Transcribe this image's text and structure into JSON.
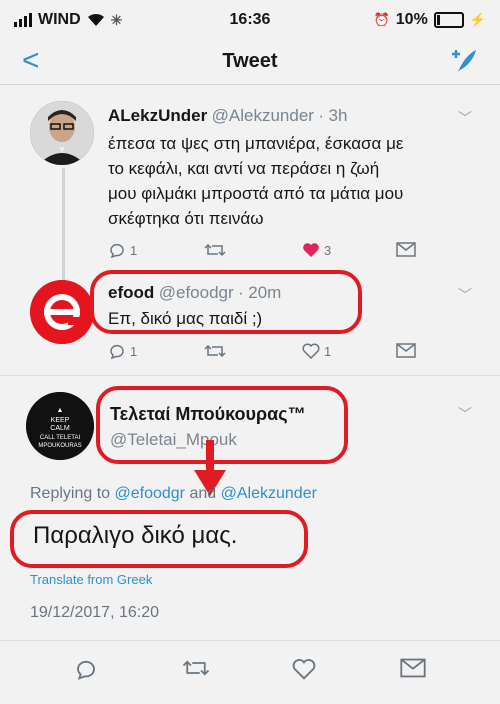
{
  "status": {
    "carrier": "WIND",
    "time": "16:36",
    "battery": "10%"
  },
  "nav": {
    "back": "<",
    "title": "Tweet"
  },
  "tweet1": {
    "name": "ALekzUnder",
    "handle": "@Alekzunder",
    "time": "3h",
    "lines": [
      "έπεσα τα ψες στη μπανιέρα, έσκασα με",
      "το κεφάλι, και αντί να περάσει η ζωή",
      "μου φιλμάκι μπροστά από τα μάτια μου",
      "σκέφτηκα ότι πεινάω"
    ],
    "reply_count": "1",
    "like_count": "3"
  },
  "tweet2": {
    "name": "efood",
    "handle": "@efoodgr",
    "time": "20m",
    "text": "Επ, δικό μας παιδί ;)",
    "reply_count": "1",
    "like_count": "1",
    "avatar_letter": "e"
  },
  "tweet3": {
    "name": "Τελεταί Μπούκουρας™",
    "handle": "@Teletai_Mpouk",
    "avatar_lines": [
      "KEEP",
      "CALM",
      "CALL TELETAI",
      "MPOUKOURAS"
    ],
    "replying_prefix": "Replying to",
    "reply_handle_1": "@efoodgr",
    "and": "and",
    "reply_handle_2": "@Alekzunder",
    "text": "Παραλιγο δικό μας.",
    "translate": "Translate from Greek",
    "timestamp": "19/12/2017, 16:20"
  },
  "colors": {
    "accent": "#2f8fcf",
    "like": "#e0245e",
    "marker": "#e01b22",
    "efood": "#e4151f"
  }
}
